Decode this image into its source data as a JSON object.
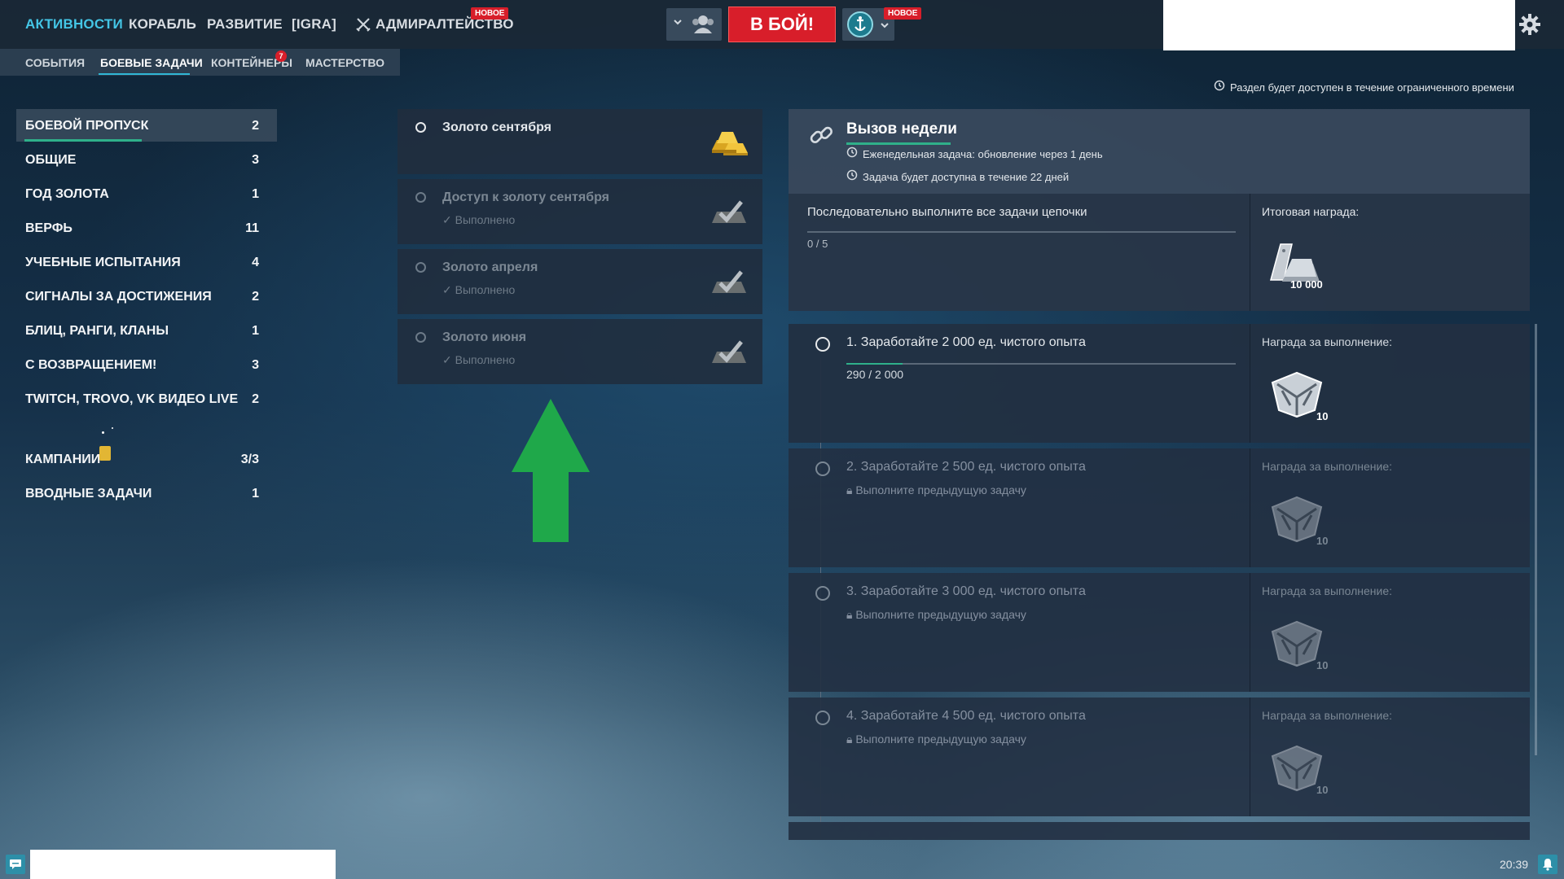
{
  "nav": {
    "items": [
      {
        "label": "АКТИВНОСТИ"
      },
      {
        "label": "КОРАБЛЬ"
      },
      {
        "label": "РАЗВИТИЕ"
      },
      {
        "label": "[IGRA]"
      },
      {
        "label": "АДМИРАЛТЕЙСТВО"
      }
    ],
    "admiralty_badge": "НОВОЕ",
    "battle_button": "В БОЙ!",
    "profile_badge": "НОВОЕ"
  },
  "subnav": {
    "items": [
      {
        "label": "СОБЫТИЯ"
      },
      {
        "label": "БОЕВЫЕ ЗАДАЧИ"
      },
      {
        "label": "КОНТЕЙНЕРЫ"
      },
      {
        "label": "МАСТЕРСТВО"
      }
    ],
    "containers_count": "7"
  },
  "notice": "Раздел будет доступен в течение ограниченного времени",
  "categories": [
    {
      "label": "БОЕВОЙ ПРОПУСК",
      "count": "2"
    },
    {
      "label": "ОБЩИЕ",
      "count": "3"
    },
    {
      "label": "ГОД ЗОЛОТА",
      "count": "1"
    },
    {
      "label": "ВЕРФЬ",
      "count": "11"
    },
    {
      "label": "УЧЕБНЫЕ ИСПЫТАНИЯ",
      "count": "4"
    },
    {
      "label": "СИГНАЛЫ ЗА ДОСТИЖЕНИЯ",
      "count": "2"
    },
    {
      "label": "БЛИЦ, РАНГИ, КЛАНЫ",
      "count": "1"
    },
    {
      "label": "С ВОЗВРАЩЕНИЕМ!",
      "count": "3"
    },
    {
      "label": "TWITCH, TROVO, VK ВИДЕО LIVE",
      "count": "2"
    },
    {
      "label": "КАМПАНИИ",
      "count": "3/3"
    },
    {
      "label": "ВВОДНЫЕ ЗАДАЧИ",
      "count": "1"
    }
  ],
  "cards": [
    {
      "title": "Золото сентября",
      "status": ""
    },
    {
      "title": "Доступ к золоту сентября",
      "status": "Выполнено"
    },
    {
      "title": "Золото апреля",
      "status": "Выполнено"
    },
    {
      "title": "Золото июня",
      "status": "Выполнено"
    }
  ],
  "weekly": {
    "title": "Вызов недели",
    "line1": "Еженедельная задача: обновление через 1 день",
    "line2": "Задача будет доступна в течение 22 дней",
    "chain_text": "Последовательно выполните все задачи цепочки",
    "chain_progress": "0 / 5",
    "final_reward_label": "Итоговая награда:",
    "final_reward_amount": "10 000"
  },
  "tasks": [
    {
      "title": "1. Заработайте 2 000 ед. чистого опыта",
      "progress": "290 / 2 000",
      "progress_value": 0.145,
      "reward_label": "Награда за выполнение:",
      "reward_amount": "10"
    },
    {
      "title": "2. Заработайте 2 500 ед. чистого опыта",
      "lock": "Выполните предыдущую задачу",
      "reward_label": "Награда за выполнение:",
      "reward_amount": "10"
    },
    {
      "title": "3. Заработайте 3 000 ед. чистого опыта",
      "lock": "Выполните предыдущую задачу",
      "reward_label": "Награда за выполнение:",
      "reward_amount": "10"
    },
    {
      "title": "4. Заработайте 4 500 ед. чистого опыта",
      "lock": "Выполните предыдущую задачу",
      "reward_label": "Награда за выполнение:",
      "reward_amount": "10"
    }
  ],
  "clock": "20:39",
  "colors": {
    "accent": "#44c6e6",
    "battle": "#d81e2a",
    "arrow": "#1fa84a",
    "progress": "#2fb08a"
  }
}
